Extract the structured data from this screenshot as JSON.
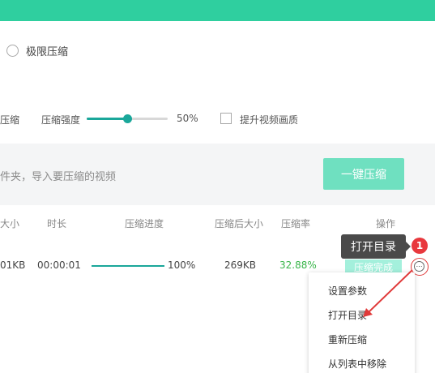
{
  "compression_modes": {
    "extreme_label": "极限压缩"
  },
  "settings": {
    "mode_cut_label": "压缩",
    "strength_label": "压缩强度",
    "strength_value": 0.5,
    "strength_text": "50%",
    "enhance_quality_label": "提升视频画质",
    "enhance_quality_checked": false
  },
  "drop_area": {
    "hint": "件夹，导入要压缩的视频",
    "compress_button": "一键压缩"
  },
  "table": {
    "headers": {
      "size": "大小",
      "duration": "时长",
      "progress": "压缩进度",
      "compressed_size": "压缩后大小",
      "ratio": "压缩率",
      "action": "操作"
    },
    "rows": [
      {
        "size": "01KB",
        "duration": "00:00:01",
        "progress": 1.0,
        "progress_text": "100%",
        "compressed_size": "269KB",
        "ratio": "32.88%",
        "status": "压缩完成"
      }
    ]
  },
  "tooltip": {
    "text": "打开目录"
  },
  "step_badge": "1",
  "context_menu": {
    "items": [
      "设置参数",
      "打开目录",
      "重新压缩",
      "从列表中移除"
    ]
  },
  "colors": {
    "brand_green": "#2fcf9f",
    "button_green": "#6fe0c0",
    "ratio_green": "#39b54a",
    "annotation_red": "#e03a3a"
  },
  "icons": {
    "more": "more-options-icon",
    "arrow": "annotation-arrow-icon"
  }
}
